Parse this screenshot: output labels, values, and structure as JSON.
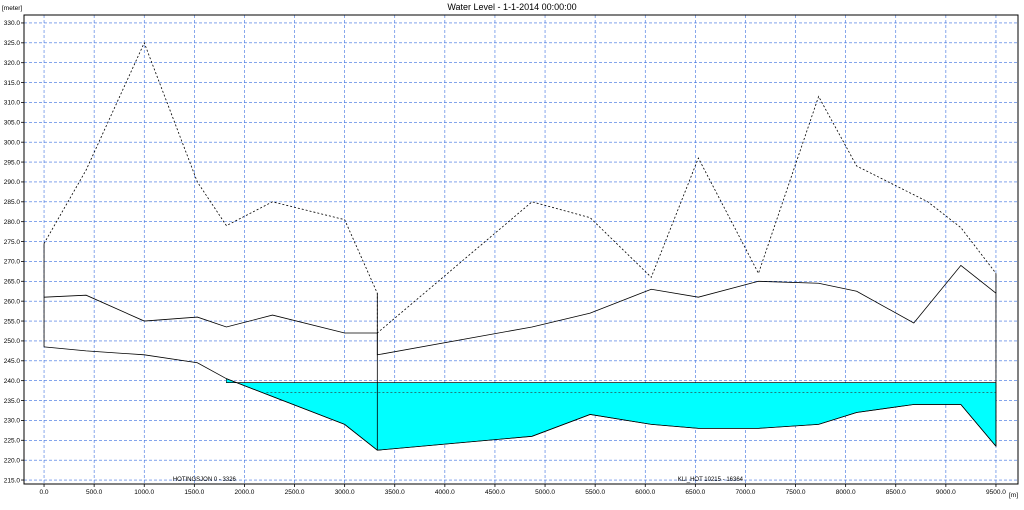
{
  "chart_data": {
    "type": "line",
    "title": "Water Level - 1-1-2014 00:00:00",
    "ylabel": "[meter]",
    "xlabel": "[m]",
    "xlim": [
      -200,
      9720
    ],
    "ylim": [
      214,
      332
    ],
    "x_ticks": [
      0,
      500,
      1000,
      1500,
      2000,
      2500,
      3000,
      3500,
      4000,
      4500,
      5000,
      5500,
      6000,
      6500,
      7000,
      7500,
      8000,
      8500,
      9000,
      9500
    ],
    "x_tick_labels": [
      "0.0",
      "500.0",
      "1000.0",
      "1500.0",
      "2000.0",
      "2500.0",
      "3000.0",
      "3500.0",
      "4000.0",
      "4500.0",
      "5000.0",
      "5500.0",
      "6000.0",
      "6500.0",
      "7000.0",
      "7500.0",
      "8000.0",
      "8500.0",
      "9000.0",
      "9500.0"
    ],
    "y_ticks": [
      215,
      220,
      225,
      230,
      235,
      240,
      245,
      250,
      255,
      260,
      265,
      270,
      275,
      280,
      285,
      290,
      295,
      300,
      305,
      310,
      315,
      320,
      325,
      330
    ],
    "y_tick_labels": [
      "215.0",
      "220.0",
      "225.0",
      "230.0",
      "235.0",
      "240.0",
      "245.0",
      "250.0",
      "255.0",
      "260.0",
      "265.0",
      "270.0",
      "275.0",
      "280.0",
      "285.0",
      "290.0",
      "295.0",
      "300.0",
      "305.0",
      "310.0",
      "315.0",
      "320.0",
      "325.0",
      "330.0"
    ],
    "grid": true,
    "branches": [
      {
        "label": "HOTINGSJON  0 - 3326",
        "x_start": 0,
        "x_end": 3326,
        "label_x": 1600
      },
      {
        "label": "KLI_HOT  10215 - 16364",
        "x_start": 3326,
        "x_end": 9500,
        "label_x": 6650
      }
    ],
    "series": [
      {
        "style": "dotted",
        "color": "#000000",
        "x": [
          0,
          420,
          1000,
          1530,
          1820,
          2280,
          3000,
          3326,
          3326,
          4870,
          5450,
          6060,
          6530,
          7130,
          7730,
          8110,
          8820,
          9150,
          9500
        ],
        "y": [
          274.5,
          293,
          325,
          290,
          279,
          285,
          280.5,
          262,
          252,
          285,
          281,
          266,
          296,
          267,
          311.5,
          294,
          285,
          278.5,
          267
        ]
      },
      {
        "style": "solid",
        "color": "#000000",
        "x": [
          0,
          420,
          1000,
          1530,
          1820,
          2280,
          3000,
          3326,
          3326,
          4870,
          5450,
          6060,
          6530,
          7130,
          7730,
          8110,
          8680,
          9150,
          9500
        ],
        "y": [
          261,
          261.5,
          255,
          256,
          253.5,
          256.5,
          252,
          252,
          246.5,
          253.5,
          257,
          263,
          261,
          265,
          264.5,
          262.5,
          254.5,
          269,
          262
        ]
      },
      {
        "style": "solid",
        "color": "#000000",
        "x": [
          0,
          420,
          1000,
          1530,
          1820,
          2280,
          3000,
          3326,
          3326,
          4870,
          5450,
          6060,
          6530,
          7130,
          7730,
          8110,
          8680,
          9150,
          9500
        ],
        "y": [
          248.5,
          247.5,
          246.5,
          244.5,
          240.5,
          236,
          229,
          222.5,
          222.5,
          226,
          231.5,
          229,
          228,
          228,
          229,
          232,
          234,
          234,
          223.5
        ]
      }
    ],
    "water": {
      "color": "#00ffff",
      "level": 239.5,
      "x": [
        1820,
        2280,
        3000,
        3326,
        3326,
        4870,
        5450,
        6060,
        6530,
        7130,
        7730,
        8110,
        8680,
        9150,
        9500
      ],
      "y": [
        240.5,
        236,
        229,
        222.5,
        222.5,
        226,
        231.5,
        229,
        228,
        228,
        229,
        232,
        234,
        234,
        223.5
      ]
    },
    "reference_line": {
      "style": "dotted",
      "y": 237
    }
  }
}
